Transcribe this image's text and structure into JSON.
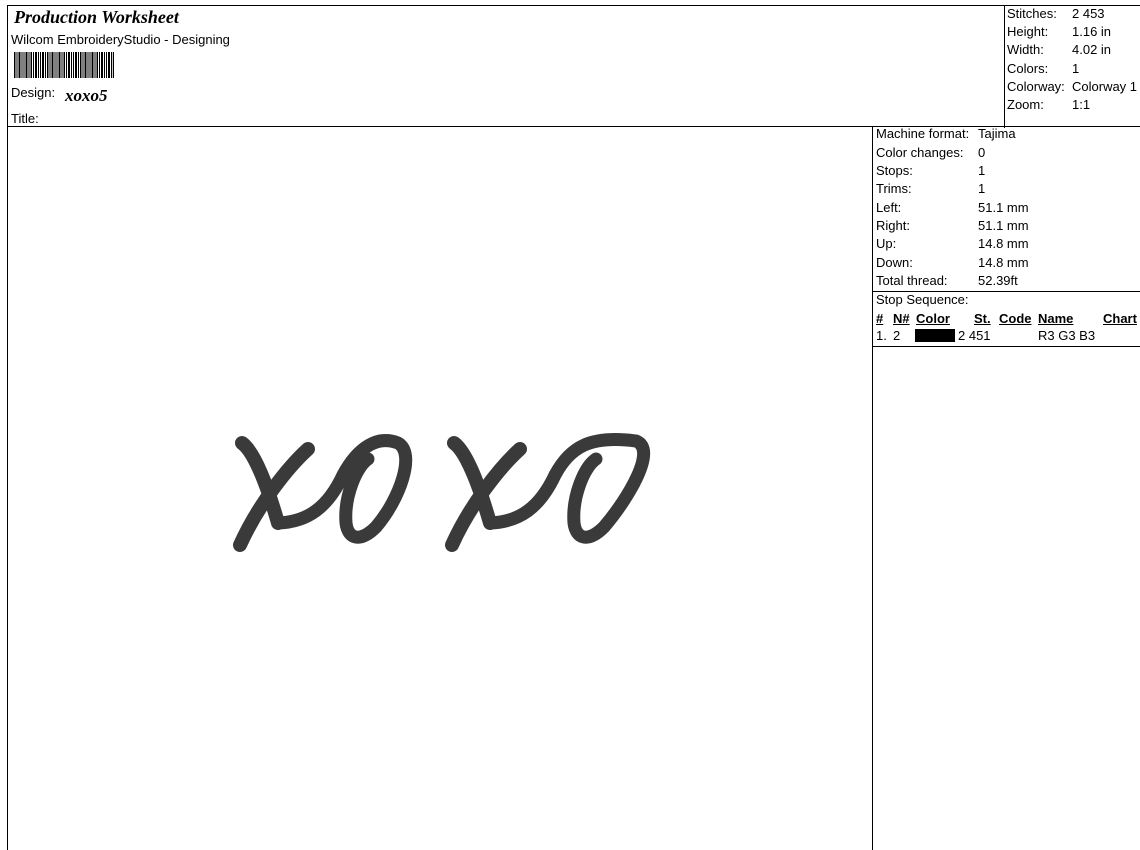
{
  "header": {
    "worksheet_title": "Production Worksheet",
    "app_line": "Wilcom EmbroideryStudio - Designing",
    "design_label": "Design:",
    "design_name": "xoxo5",
    "title_label": "Title:"
  },
  "summary": {
    "rows": [
      {
        "label": "Stitches:",
        "value": "2 453"
      },
      {
        "label": "Height:",
        "value": "1.16 in"
      },
      {
        "label": "Width:",
        "value": "4.02 in"
      },
      {
        "label": "Colors:",
        "value": "1"
      },
      {
        "label": "Colorway:",
        "value": "Colorway 1"
      },
      {
        "label": "Zoom:",
        "value": "1:1"
      }
    ]
  },
  "details": {
    "rows": [
      {
        "label": "Machine format:",
        "value": "Tajima"
      },
      {
        "label": "Color changes:",
        "value": "0"
      },
      {
        "label": "Stops:",
        "value": "1"
      },
      {
        "label": "Trims:",
        "value": "1"
      },
      {
        "label": "Left:",
        "value": "51.1 mm"
      },
      {
        "label": "Right:",
        "value": "51.1 mm"
      },
      {
        "label": "Up:",
        "value": "14.8 mm"
      },
      {
        "label": "Down:",
        "value": "14.8 mm"
      },
      {
        "label": "Total thread:",
        "value": "52.39ft"
      }
    ],
    "stop_sequence_title": "Stop Sequence:",
    "columns": [
      "#",
      "N#",
      "Color",
      "St.",
      "Code",
      "Name",
      "Chart"
    ],
    "stops": [
      {
        "index": "1.",
        "needle": "2",
        "color": "#000000",
        "stitches": "2 451",
        "code": "",
        "name": "R3 G3 B3",
        "chart": ""
      }
    ]
  },
  "design_preview": {
    "thread_color": "#3a3a3a"
  }
}
